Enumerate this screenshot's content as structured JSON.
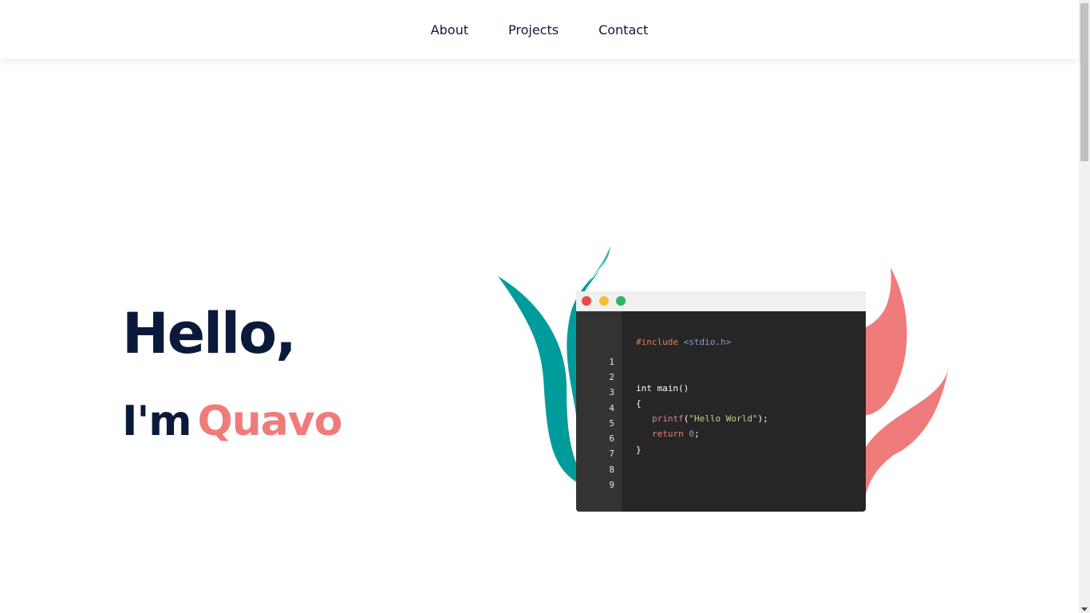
{
  "nav": {
    "links": [
      {
        "label": "About"
      },
      {
        "label": "Projects"
      },
      {
        "label": "Contact"
      }
    ]
  },
  "hero": {
    "greeting": "Hello,",
    "intro_prefix": "I'm",
    "name": "Quavo"
  },
  "code_window": {
    "line_numbers": [
      "1",
      "2",
      "3",
      "4",
      "5",
      "6",
      "7",
      "8",
      "9"
    ],
    "code": {
      "include_directive": "#include",
      "include_header": "<stdio.h>",
      "main_signature": "int main()",
      "open_brace": "{",
      "printf_fn": "printf",
      "printf_open": "(",
      "printf_string": "\"Hello World\"",
      "printf_close": ");",
      "return_kw": "return",
      "return_value": "0",
      "return_semicolon": ";",
      "close_brace": "}"
    },
    "dots": [
      "close",
      "minimize",
      "maximize"
    ]
  },
  "colors": {
    "navy": "#0b1a3b",
    "accent_coral": "#f07b7b",
    "teal": "#009c9c",
    "editor_bg": "#262626",
    "gutter_bg": "#333333",
    "titlebar_bg": "#f0f0f0"
  }
}
